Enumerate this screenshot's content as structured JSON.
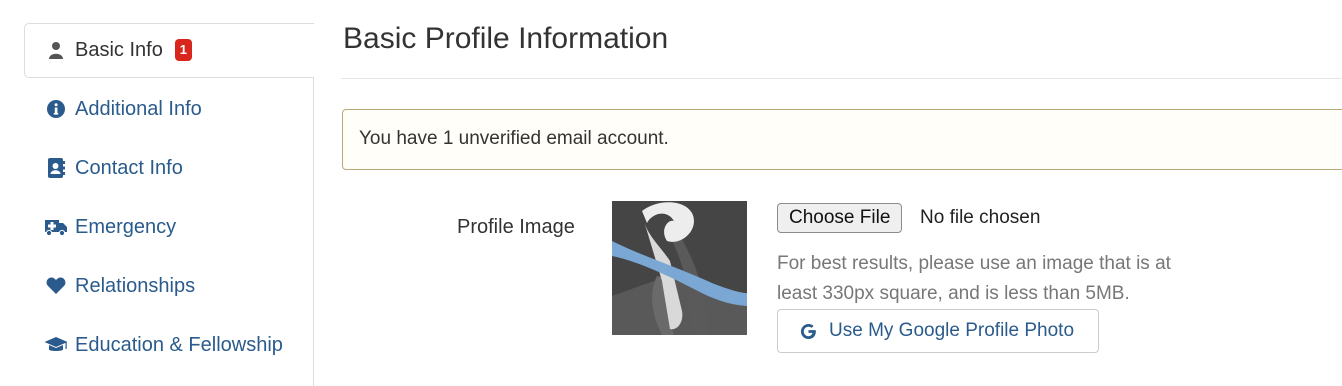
{
  "sidebar": {
    "items": [
      {
        "label": "Basic Info",
        "icon": "user-icon",
        "badge": "1",
        "active": true
      },
      {
        "label": "Additional Info",
        "icon": "info-circle-icon"
      },
      {
        "label": "Contact Info",
        "icon": "address-book-icon"
      },
      {
        "label": "Emergency",
        "icon": "ambulance-icon"
      },
      {
        "label": "Relationships",
        "icon": "heart-icon"
      },
      {
        "label": "Education & Fellowship",
        "icon": "graduation-cap-icon"
      }
    ]
  },
  "main": {
    "title": "Basic Profile Information",
    "alert": "You have 1 unverified email account.",
    "profile_image": {
      "label": "Profile Image",
      "file_button": "Choose File",
      "file_status": "No file chosen",
      "help": "For best results, please use an image that is at least 330px square, and is less than 5MB.",
      "google_button": "Use My Google Profile Photo"
    }
  },
  "colors": {
    "link": "#2a5b8c",
    "badge": "#d9261c",
    "alert_border": "#b9a87a",
    "ribbon_blue": "#7aa7d3",
    "ribbon_white": "#e6e6e6"
  }
}
